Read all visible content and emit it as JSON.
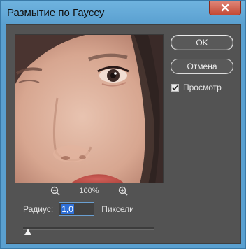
{
  "window": {
    "title": "Размытие по Гауссу"
  },
  "buttons": {
    "ok": "OK",
    "cancel": "Отмена"
  },
  "preview_checkbox": {
    "label": "Просмотр",
    "checked": true
  },
  "zoom": {
    "level": "100%"
  },
  "radius": {
    "label": "Радиус:",
    "value": "1,0",
    "unit": "Пиксели",
    "slider_fraction": 0.04
  },
  "colors": {
    "accent": "#2e6fd6",
    "panel": "#535353",
    "titlebar": "#5aa0d0",
    "close": "#c44a36"
  }
}
